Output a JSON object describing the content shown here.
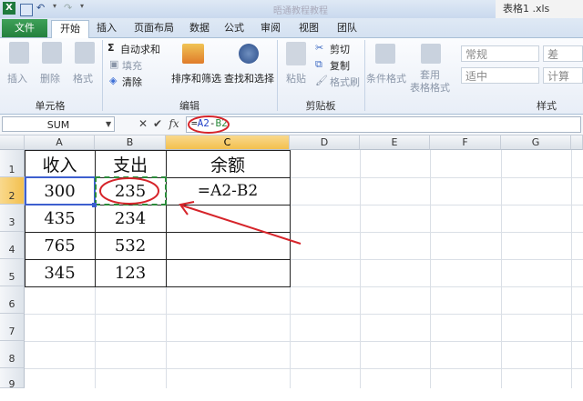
{
  "window": {
    "quick_access": {
      "undo": "↶",
      "redo": "↷"
    },
    "title_faded": "晤通教程教程",
    "file_title": "表格1 .xls"
  },
  "tabs": [
    "文件",
    "开始",
    "插入",
    "页面布局",
    "数据",
    "公式",
    "审阅",
    "视图",
    "团队"
  ],
  "ribbon": {
    "cells_group": {
      "buttons": [
        "插入",
        "删除",
        "格式"
      ],
      "label": "单元格"
    },
    "edit_group": {
      "items": [
        "自动求和",
        "填充",
        "清除"
      ],
      "sort_filter": "排序和筛选",
      "find_select": "查找和选择",
      "label": "编辑"
    },
    "clipboard_group": {
      "paste": "粘贴",
      "cut": "剪切",
      "copy": "复制",
      "format_painter": "格式刷",
      "label": "剪贴板"
    },
    "styles_group": {
      "conditional": "条件格式",
      "table_format": "套用\n表格格式",
      "cell_styles": [
        "常规",
        "差",
        "适中",
        "计算"
      ],
      "label": "样式"
    }
  },
  "formula_bar": {
    "name_box": "SUM",
    "cancel": "✕",
    "enter": "✔",
    "fx": "fx",
    "formula": "=A2-B2"
  },
  "grid": {
    "columns": [
      "A",
      "B",
      "C",
      "D",
      "E",
      "F",
      "G"
    ],
    "rows": [
      "1",
      "2",
      "3",
      "4",
      "5",
      "6",
      "7",
      "8",
      "9"
    ],
    "selected_column": "C",
    "selected_row": "2",
    "cells": {
      "A1": "收入",
      "B1": "支出",
      "C1": "余额",
      "A2": "300",
      "B2": "235",
      "C2": "=A2-B2",
      "A3": "435",
      "B3": "234",
      "A4": "765",
      "B4": "532",
      "A5": "345",
      "B5": "123"
    }
  },
  "colors": {
    "file_tab": "#2e8b4a",
    "formula_ref_a": "#2140c9",
    "formula_ref_b": "#2a8a3a",
    "annotation": "#d6242a",
    "selected_header": "#f5c75c"
  }
}
